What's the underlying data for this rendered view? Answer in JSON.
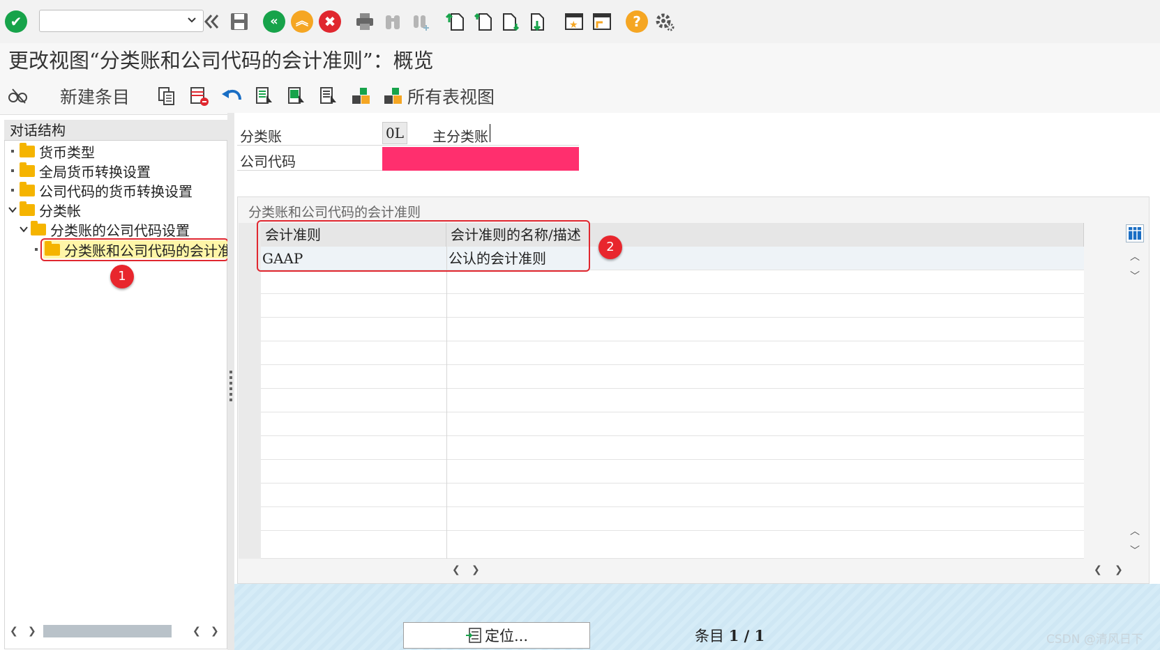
{
  "toolbar": {
    "command_field_value": "",
    "icons": [
      "enter-check-icon",
      "command-dropdown-icon",
      "collapse-double-left-icon",
      "save-icon",
      "back-icon",
      "exit-icon",
      "cancel-icon",
      "print-icon",
      "find-icon",
      "find-next-icon",
      "first-page-icon",
      "previous-page-icon",
      "next-page-icon",
      "last-page-icon",
      "create-session-icon",
      "shortcut-icon",
      "help-icon",
      "settings-gear-icon"
    ]
  },
  "title": "更改视图“分类账和公司代码的会计准则”：概览",
  "app_toolbar": {
    "new_entries": "新建条目",
    "all_views": "所有表视图"
  },
  "tree": {
    "header": "对话结构",
    "nodes": [
      {
        "label": "货币类型"
      },
      {
        "label": "全局货币转换设置"
      },
      {
        "label": "公司代码的货币转换设置"
      },
      {
        "label": "分类帐"
      },
      {
        "label": "分类账的公司代码设置"
      },
      {
        "label": "分类账和公司代码的会计准"
      }
    ]
  },
  "fields": {
    "ledger_label": "分类账",
    "ledger_value": "0L",
    "ledger_desc": "主分类账",
    "company_code_label": "公司代码",
    "company_code_value": ""
  },
  "table": {
    "title": "分类账和公司代码的会计准则",
    "columns": [
      "会计准则",
      "会计准则的名称/描述"
    ],
    "rows": [
      [
        "GAAP",
        "公认的会计准则"
      ]
    ]
  },
  "annotations": {
    "badge1": "1",
    "badge2": "2"
  },
  "footer": {
    "position_button": "定位...",
    "entries_label": "条目",
    "entries_value": "1 / 1",
    "watermark": "CSDN @清风日下"
  },
  "colors": {
    "redact": "#ff2f6e",
    "annotation_red": "#e0272f",
    "selected_row": "#fff6a8"
  }
}
